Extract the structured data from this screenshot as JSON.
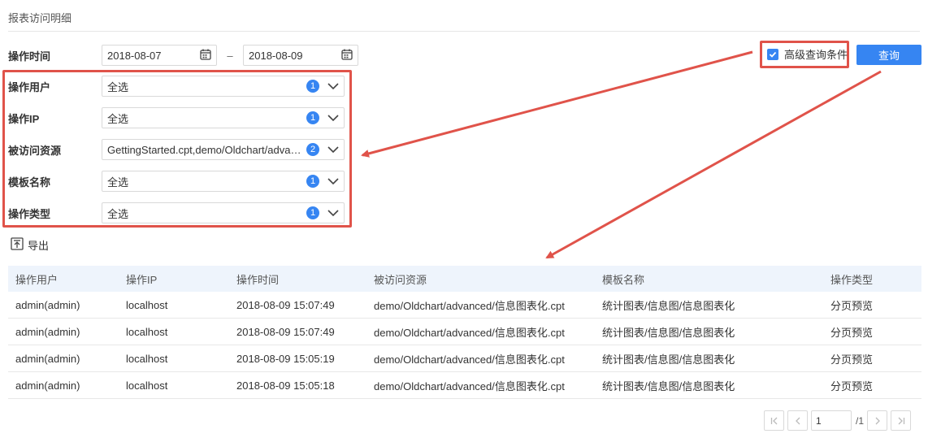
{
  "page_title": "报表访问明细",
  "time": {
    "label": "操作时间",
    "start": "2018-08-07",
    "dash": "–",
    "end": "2018-08-09"
  },
  "filters": [
    {
      "label": "操作用户",
      "value": "全选",
      "count": "1"
    },
    {
      "label": "操作IP",
      "value": "全选",
      "count": "1"
    },
    {
      "label": "被访问资源",
      "value": "GettingStarted.cpt,demo/Oldchart/advan...",
      "count": "2"
    },
    {
      "label": "模板名称",
      "value": "全选",
      "count": "1"
    },
    {
      "label": "操作类型",
      "value": "全选",
      "count": "1"
    }
  ],
  "advanced": {
    "label": "高级查询条件",
    "checked": true
  },
  "query_button": "查询",
  "export_label": "导出",
  "table": {
    "headers": [
      "操作用户",
      "操作IP",
      "操作时间",
      "被访问资源",
      "模板名称",
      "操作类型"
    ],
    "rows": [
      [
        "admin(admin)",
        "localhost",
        "2018-08-09 15:07:49",
        "demo/Oldchart/advanced/信息图表化.cpt",
        "统计图表/信息图/信息图表化",
        "分页预览"
      ],
      [
        "admin(admin)",
        "localhost",
        "2018-08-09 15:07:49",
        "demo/Oldchart/advanced/信息图表化.cpt",
        "统计图表/信息图/信息图表化",
        "分页预览"
      ],
      [
        "admin(admin)",
        "localhost",
        "2018-08-09 15:05:19",
        "demo/Oldchart/advanced/信息图表化.cpt",
        "统计图表/信息图/信息图表化",
        "分页预览"
      ],
      [
        "admin(admin)",
        "localhost",
        "2018-08-09 15:05:18",
        "demo/Oldchart/advanced/信息图表化.cpt",
        "统计图表/信息图/信息图表化",
        "分页预览"
      ]
    ]
  },
  "pager": {
    "current": "1",
    "total": "/1"
  },
  "colors": {
    "accent": "#3685f2",
    "annotation": "#e0534a",
    "header_bg": "#eef4fc"
  },
  "icons": [
    "calendar-icon",
    "chevron-down-icon",
    "check-icon",
    "export-icon",
    "first-page-icon",
    "prev-page-icon",
    "next-page-icon",
    "last-page-icon"
  ]
}
